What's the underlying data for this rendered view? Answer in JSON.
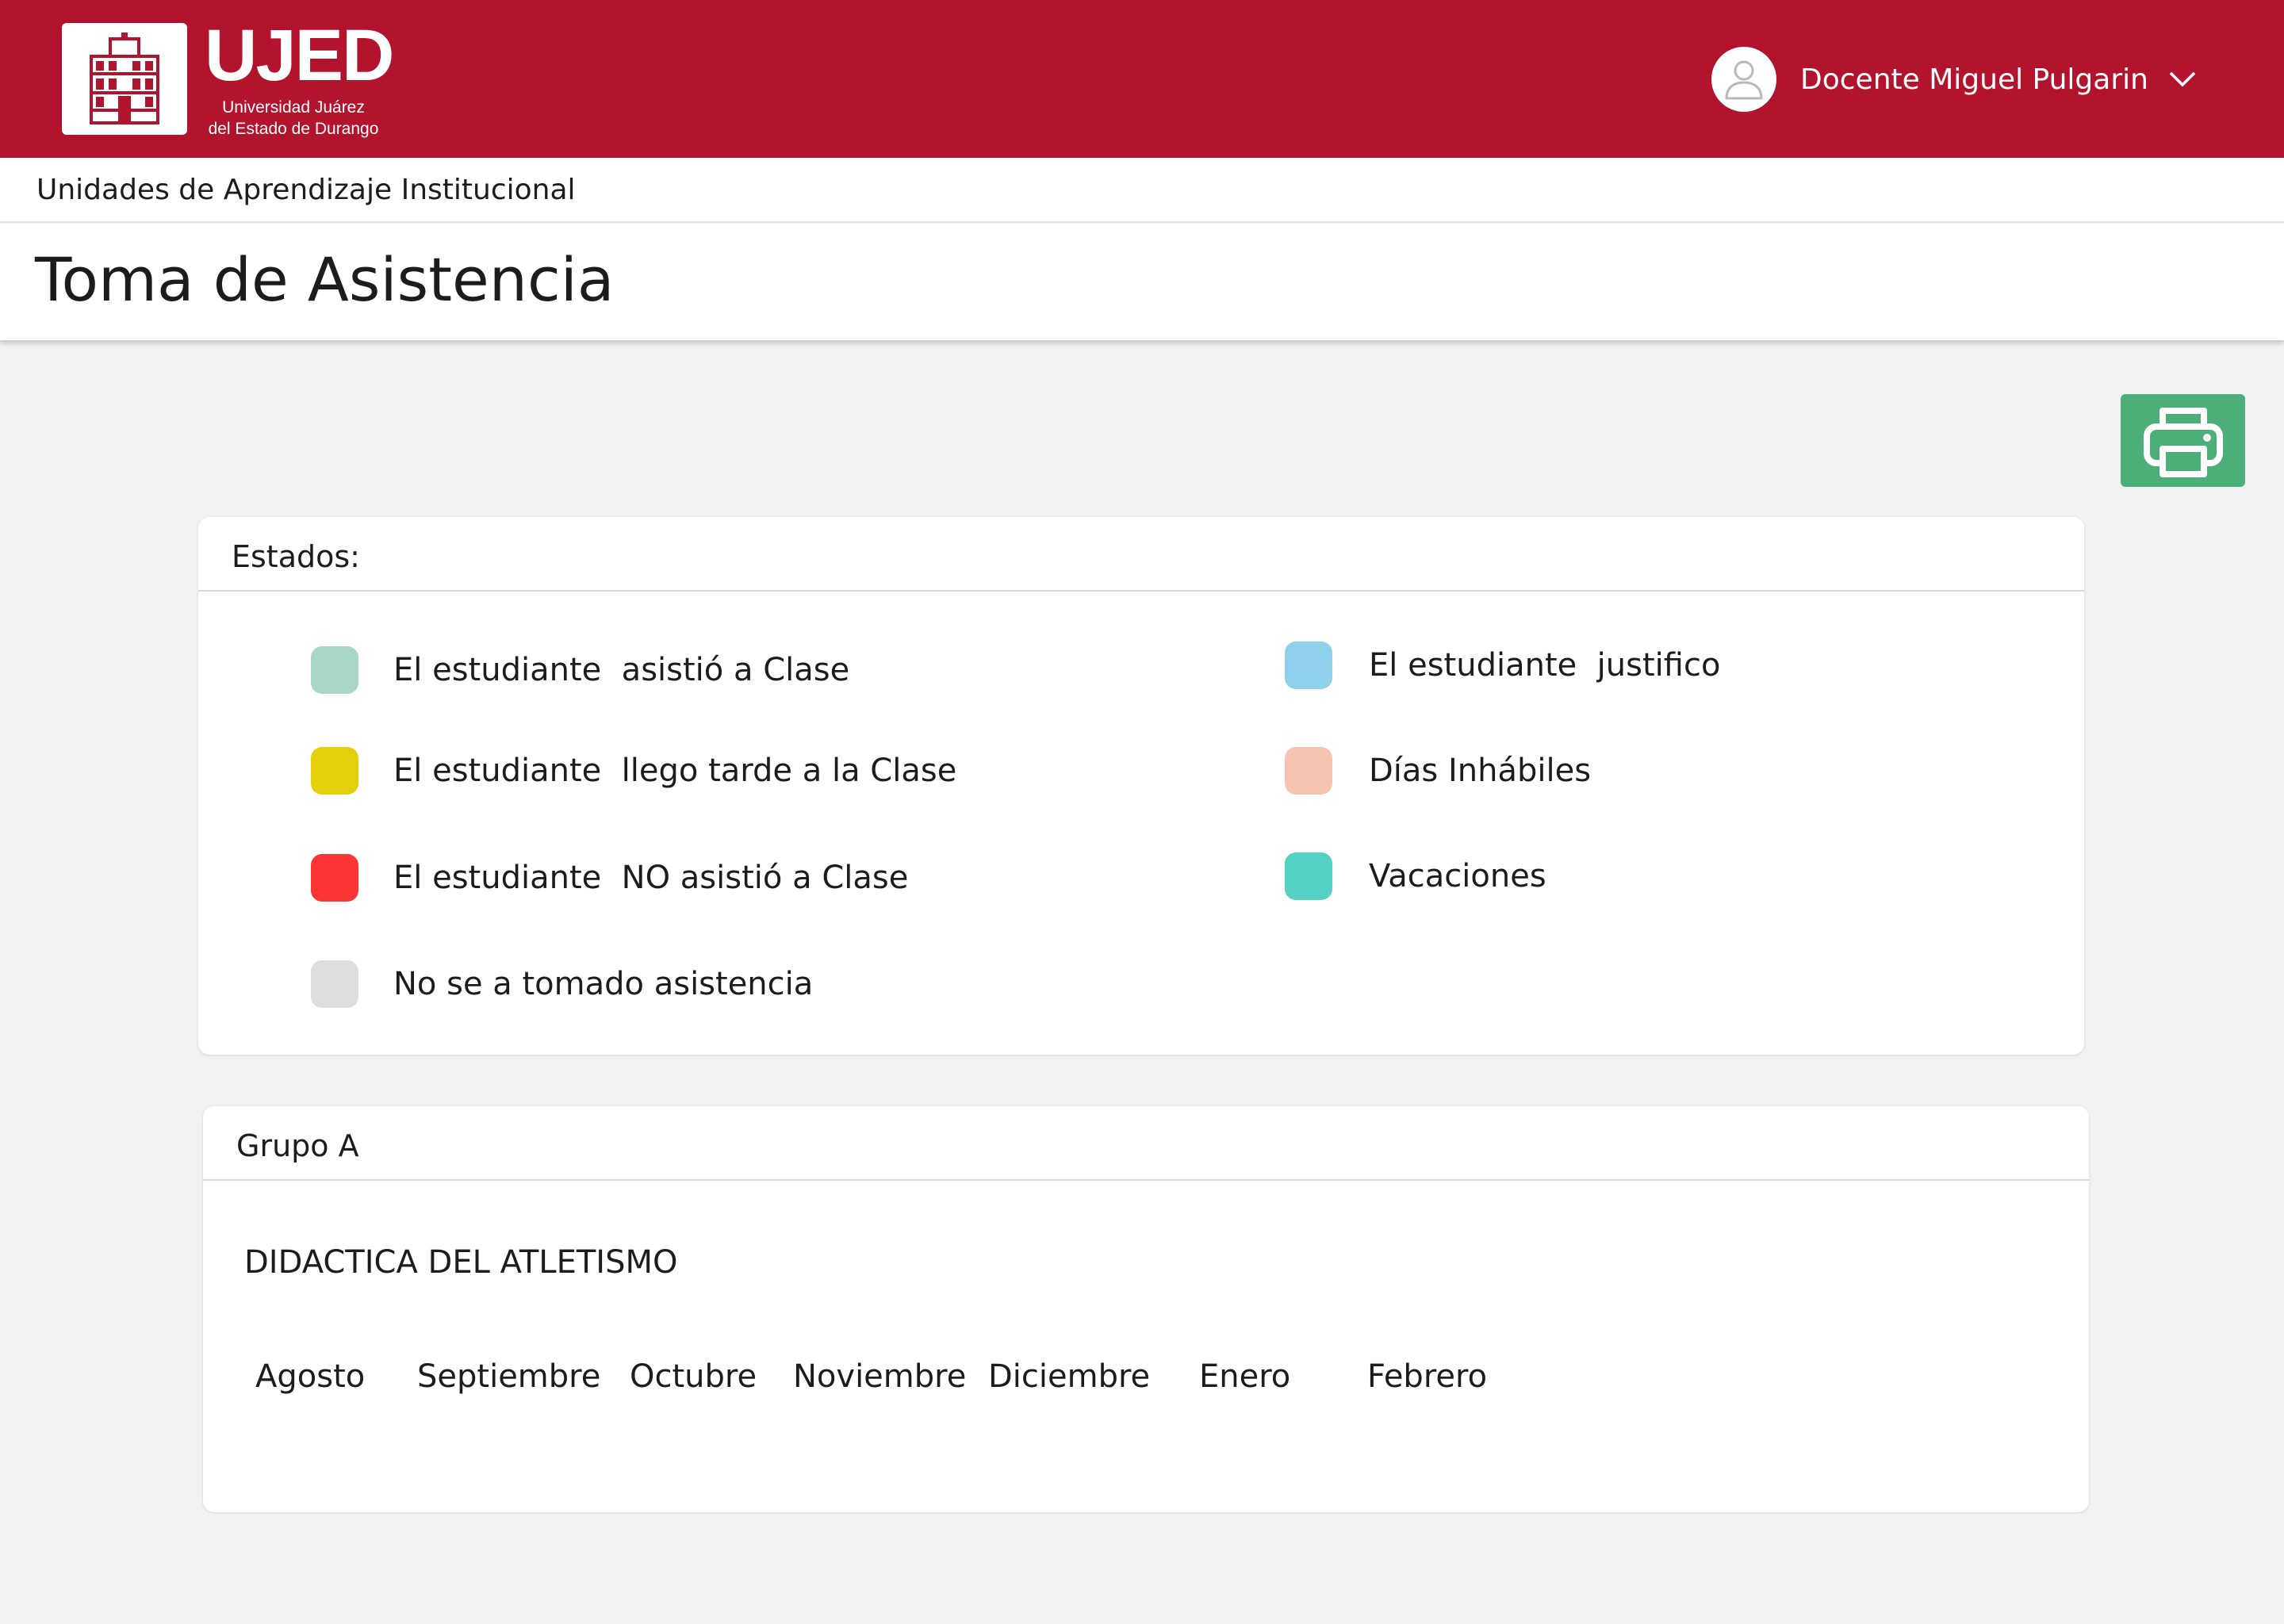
{
  "header": {
    "logo_title": "UJED",
    "logo_subtitle_1": "Universidad Juárez",
    "logo_subtitle_2": "del Estado de Durango",
    "user_name": "Docente Miguel Pulgarin",
    "brand_color": "#b3142d"
  },
  "breadcrumb": "Unidades de Aprendizaje Institucional",
  "page_title": "Toma de Asistencia",
  "print_button": {
    "icon": "printer-icon",
    "color": "#4caf7a"
  },
  "estados": {
    "title": "Estados:",
    "items": [
      {
        "label": "El estudiante  asistió a Clase",
        "color": "#a8d8c5"
      },
      {
        "label": "El estudiante  llego tarde a la Clase",
        "color": "#e4cf0b"
      },
      {
        "label": "El estudiante  NO asistió a Clase",
        "color": "#fb3535"
      },
      {
        "label": "No se a tomado asistencia",
        "color": "#dddddd"
      },
      {
        "label": "El estudiante  justifico",
        "color": "#8fd0ec"
      },
      {
        "label": "Días Inhábiles",
        "color": "#f4c4b0"
      },
      {
        "label": "Vacaciones",
        "color": "#55d0c5"
      }
    ]
  },
  "grupo": {
    "title": "Grupo A",
    "course": "DIDACTICA DEL ATLETISMO",
    "months": [
      "Agosto",
      "Septiembre",
      "Octubre",
      "Noviembre",
      "Diciembre",
      "Enero",
      "Febrero"
    ]
  }
}
